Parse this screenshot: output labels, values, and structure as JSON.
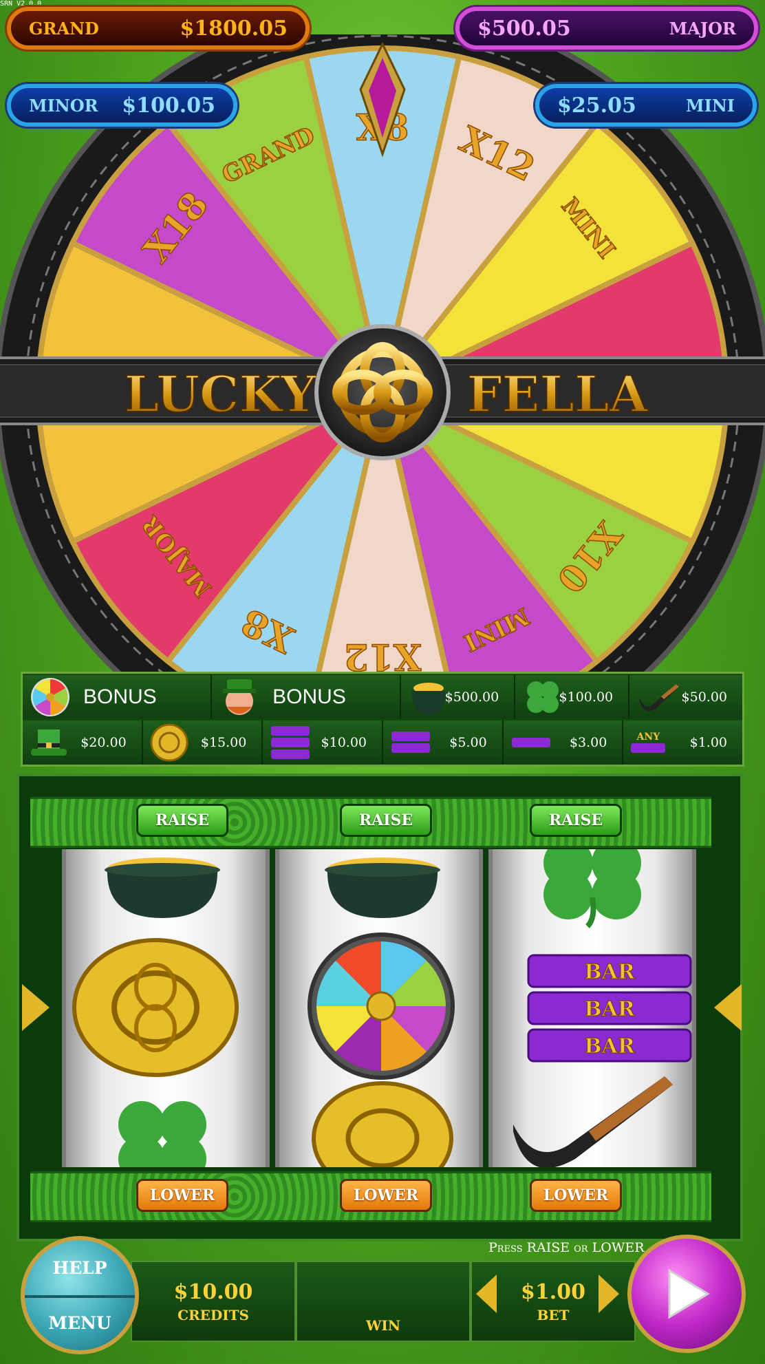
{
  "version": "SRN V2.0.0",
  "jackpots": {
    "grand": {
      "label": "GRAND",
      "value": "$1800.05"
    },
    "major": {
      "label": "MAJOR",
      "value": "$500.05"
    },
    "minor": {
      "label": "MINOR",
      "value": "$100.05"
    },
    "mini": {
      "label": "MINI",
      "value": "$25.05"
    }
  },
  "wheel": {
    "title_left": "LUCKY",
    "title_right": "FELLA",
    "segments": [
      {
        "label": "X8",
        "color": "#9bd7ee"
      },
      {
        "label": "X12",
        "color": "#f0d7c8"
      },
      {
        "label": "MINI",
        "color": "#f2e23a"
      },
      {
        "label": "",
        "color": "#e23a6a"
      },
      {
        "label": "",
        "color": "#f2e23a"
      },
      {
        "label": "X10",
        "color": "#9bd040"
      },
      {
        "label": "MINI",
        "color": "#c54ac8"
      },
      {
        "label": "X12",
        "color": "#f0d7c8"
      },
      {
        "label": "X8",
        "color": "#9bd7ee"
      },
      {
        "label": "MAJOR",
        "color": "#e23a6a"
      },
      {
        "label": "",
        "color": "#f2c23a"
      },
      {
        "label": "",
        "color": "#f2c23a"
      },
      {
        "label": "X18",
        "color": "#c54ac8"
      },
      {
        "label": "GRAND",
        "color": "#9bd040"
      }
    ]
  },
  "paytable": {
    "row1": [
      {
        "icon": "wheel-icon",
        "text": "BONUS"
      },
      {
        "icon": "leprechaun-icon",
        "text": "BONUS"
      },
      {
        "icon": "pot-of-gold-icon",
        "text": "$500.00"
      },
      {
        "icon": "clover-icon",
        "text": "$100.00"
      },
      {
        "icon": "pipe-icon",
        "text": "$50.00"
      }
    ],
    "row2": [
      {
        "icon": "hat-icon",
        "text": "$20.00"
      },
      {
        "icon": "coin-icon",
        "text": "$15.00"
      },
      {
        "icon": "triple-bar-icon",
        "text": "$10.00"
      },
      {
        "icon": "double-bar-icon",
        "text": "$5.00"
      },
      {
        "icon": "single-bar-icon",
        "text": "$3.00"
      },
      {
        "icon": "any-bar-icon",
        "text": "$1.00",
        "prefix": "ANY"
      }
    ]
  },
  "reels": {
    "raise_label": "RAISE",
    "lower_label": "LOWER",
    "bar_label": "BAR",
    "columns": [
      [
        "pot-of-gold",
        "celtic-coin",
        "clover"
      ],
      [
        "pot-of-gold",
        "bonus-wheel",
        "celtic-coin"
      ],
      [
        "clover",
        "triple-bar",
        "pipe"
      ]
    ]
  },
  "bottom": {
    "help_label": "HELP",
    "menu_label": "MENU",
    "credits_value": "$10.00",
    "credits_label": "CREDITS",
    "win_value": "",
    "win_label": "WIN",
    "bet_value": "$1.00",
    "bet_label": "BET",
    "hint": "Press RAISE or LOWER"
  }
}
